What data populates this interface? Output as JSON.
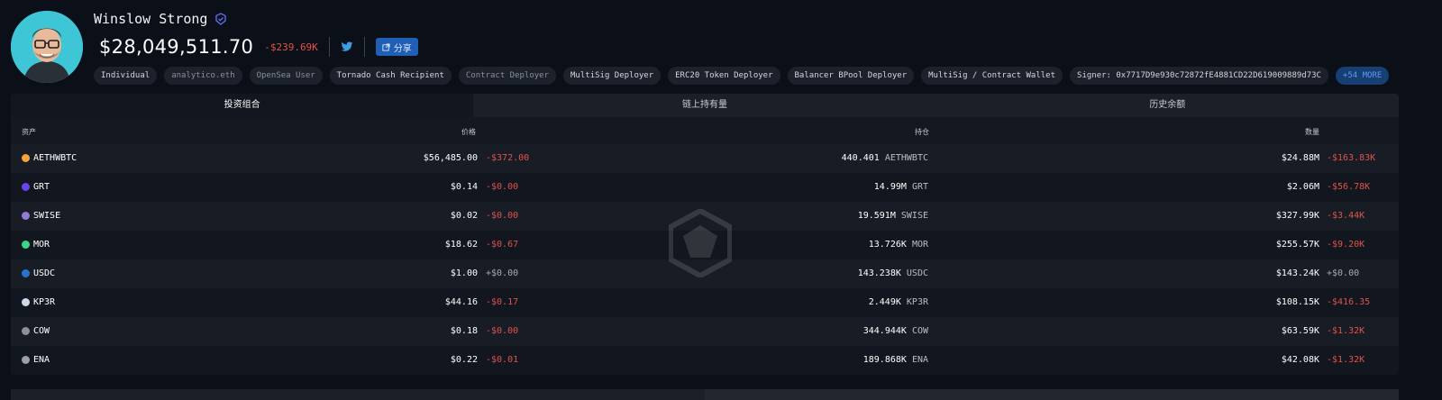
{
  "profile": {
    "name": "Winslow Strong",
    "balance": "$28,049,511.70",
    "change": "-$239.69K",
    "share_label": "分享"
  },
  "tags": [
    {
      "label": "Individual",
      "dim": false
    },
    {
      "label": "analytico.eth",
      "dim": true
    },
    {
      "label": "OpenSea User",
      "dim": true
    },
    {
      "label": "Tornado Cash Recipient",
      "dim": false
    },
    {
      "label": "Contract Deployer",
      "dim": true
    },
    {
      "label": "MultiSig Deployer",
      "dim": false
    },
    {
      "label": "ERC20 Token Deployer",
      "dim": false
    },
    {
      "label": "Balancer BPool Deployer",
      "dim": false
    },
    {
      "label": "MultiSig / Contract Wallet",
      "dim": false
    },
    {
      "label": "Signer: 0x7717D9e930c72872fE4881CD22D619009889d73C",
      "dim": false
    }
  ],
  "more_tags": "+54 MORE",
  "tabs": [
    "投资组合",
    "链上持有量",
    "历史余额"
  ],
  "table": {
    "headers": {
      "asset": "资产",
      "price": "价格",
      "holding": "持仓",
      "value": "数量"
    },
    "rows": [
      {
        "asset": "AETHWBTC",
        "icon": "wbtc-icon",
        "color": "#f2a33a",
        "price": "$56,485.00",
        "price_change": "-$372.00",
        "amount": "440.401",
        "symbol": "AETHWBTC",
        "value": "$24.88M",
        "value_change": "-$163.83K"
      },
      {
        "asset": "GRT",
        "icon": "grt-icon",
        "color": "#6747ed",
        "price": "$0.14",
        "price_change": "-$0.00",
        "amount": "14.99M",
        "symbol": "GRT",
        "value": "$2.06M",
        "value_change": "-$56.78K"
      },
      {
        "asset": "SWISE",
        "icon": "swise-icon",
        "color": "#8f7bd6",
        "price": "$0.02",
        "price_change": "-$0.00",
        "amount": "19.591M",
        "symbol": "SWISE",
        "value": "$327.99K",
        "value_change": "-$3.44K"
      },
      {
        "asset": "MOR",
        "icon": "mor-icon",
        "color": "#3ed38a",
        "price": "$18.62",
        "price_change": "-$0.67",
        "amount": "13.726K",
        "symbol": "MOR",
        "value": "$255.57K",
        "value_change": "-$9.20K"
      },
      {
        "asset": "USDC",
        "icon": "usdc-icon",
        "color": "#2775ca",
        "price": "$1.00",
        "price_change": "+$0.00",
        "amount": "143.238K",
        "symbol": "USDC",
        "value": "$143.24K",
        "value_change": "+$0.00"
      },
      {
        "asset": "KP3R",
        "icon": "kp3r-icon",
        "color": "#cfd8e8",
        "price": "$44.16",
        "price_change": "-$0.17",
        "amount": "2.449K",
        "symbol": "KP3R",
        "value": "$108.15K",
        "value_change": "-$416.35"
      },
      {
        "asset": "COW",
        "icon": "cow-icon",
        "color": "#8f8f98",
        "price": "$0.18",
        "price_change": "-$0.00",
        "amount": "344.944K",
        "symbol": "COW",
        "value": "$63.59K",
        "value_change": "-$1.32K"
      },
      {
        "asset": "ENA",
        "icon": "ena-icon",
        "color": "#9aa0aa",
        "price": "$0.22",
        "price_change": "-$0.01",
        "amount": "189.868K",
        "symbol": "ENA",
        "value": "$42.08K",
        "value_change": "-$1.32K"
      }
    ]
  }
}
